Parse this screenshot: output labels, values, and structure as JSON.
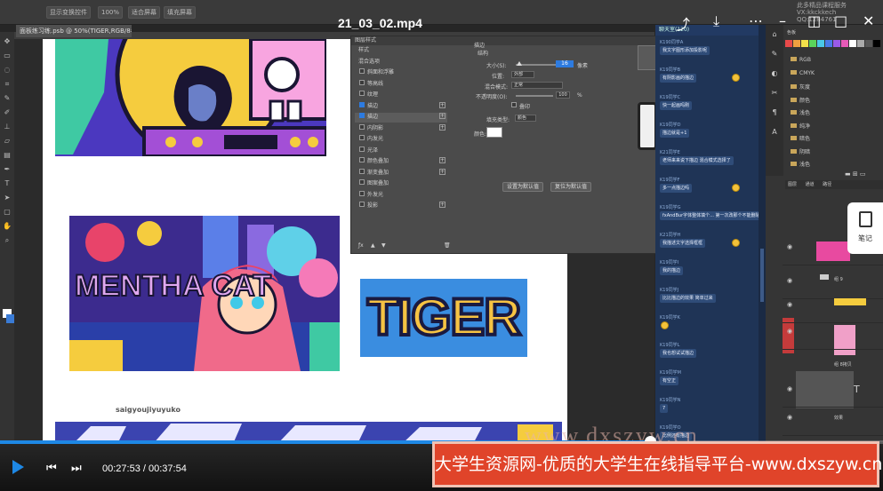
{
  "video": {
    "title": "21_03_02.mp4",
    "current_time": "00:27:53",
    "total_time": "00:37:54",
    "time_separator": "/",
    "progress_fraction": 0.736,
    "watermark_lines": [
      "此多精品课程服务",
      "VX:kkckkech",
      "QQ:1284761"
    ],
    "ghost_watermark": "www.dxszyw.cn",
    "banner_text": "大学生资源网-优质的大学生在线指导平台-www.dxszyw.cn",
    "accent_color": "#1e88e5"
  },
  "ps": {
    "option_pills": [
      "显示变换控件",
      "100%",
      "适合屏幕",
      "填充屏幕"
    ],
    "doc_tab": "面板练习练.psb @ 50%(TIGER,RGB/8#) *",
    "signature": "saigyoujiyuyuko",
    "tiger_text": "TIGER",
    "art_text": "MENTHA CAT"
  },
  "dialog": {
    "title": "图层样式",
    "left_items": [
      {
        "label": "样式",
        "checked": null,
        "plus": false
      },
      {
        "label": "混合选项",
        "checked": null,
        "plus": false
      },
      {
        "label": "斜面和浮雕",
        "checked": false,
        "plus": false
      },
      {
        "label": "等高线",
        "checked": false,
        "plus": false
      },
      {
        "label": "纹理",
        "checked": false,
        "plus": false
      },
      {
        "label": "描边",
        "checked": true,
        "plus": true
      },
      {
        "label": "描边",
        "checked": true,
        "plus": true
      },
      {
        "label": "内阴影",
        "checked": false,
        "plus": true
      },
      {
        "label": "内发光",
        "checked": false,
        "plus": false
      },
      {
        "label": "光泽",
        "checked": false,
        "plus": false
      },
      {
        "label": "颜色叠加",
        "checked": false,
        "plus": true
      },
      {
        "label": "渐变叠加",
        "checked": false,
        "plus": true
      },
      {
        "label": "图案叠加",
        "checked": false,
        "plus": false
      },
      {
        "label": "外发光",
        "checked": false,
        "plus": false
      },
      {
        "label": "投影",
        "checked": false,
        "plus": true
      }
    ],
    "section_title": "描边",
    "section_sub": "结构",
    "size_label": "大小(S):",
    "size_value": "16",
    "size_unit": "像素",
    "position_label": "位置:",
    "position_value": "外部",
    "blend_label": "混合模式:",
    "blend_value": "正常",
    "opacity_label": "不透明度(O):",
    "opacity_value": "100",
    "opacity_unit": "%",
    "overprint_label": "叠印",
    "fill_type_label": "填充类型:",
    "fill_type_value": "颜色",
    "color_label": "颜色:",
    "stroke_color": "#ffffff",
    "btn_default": "设置为默认值",
    "btn_reset": "复位为默认值"
  },
  "chat": {
    "header": "聊天室(120)",
    "messages": [
      {
        "name": "K190同学A",
        "text": "我文字图形添加投影呢"
      },
      {
        "name": "K19同学B",
        "text": "有阴影画的描边",
        "emoji": true
      },
      {
        "name": "K19同学C",
        "text": "快一起画吗刚"
      },
      {
        "name": "K19同学D",
        "text": "描边就是+1"
      },
      {
        "name": "K21同学E",
        "text": "老师来来说下描边 混合模式选择了"
      },
      {
        "name": "K19同学F",
        "text": "多一点描边吗",
        "emoji": true
      },
      {
        "name": "K19同学G",
        "text": "fxAndBur字体整体填个... 第一次改那个不能删除吗"
      },
      {
        "name": "K21同学H",
        "text": "我描述文字选择框框",
        "emoji": true
      },
      {
        "name": "K19同学I",
        "text": "我的描边"
      },
      {
        "name": "K19同学J",
        "text": "比比描边的效果 简单过来"
      },
      {
        "name": "K19同学K",
        "text": "",
        "emoji": true
      },
      {
        "name": "K19同学L",
        "text": "我也想试试描边"
      },
      {
        "name": "K19同学M",
        "text": "有空正"
      },
      {
        "name": "K19同学N",
        "text": "7"
      },
      {
        "name": "K19同学O",
        "text": "比例还有描边"
      }
    ]
  },
  "panels": {
    "top_label": "色板",
    "swatch_colors": [
      "#e84a4a",
      "#f0a040",
      "#f3e04a",
      "#5ad45a",
      "#4ac8e8",
      "#4a7ae8",
      "#9a5ae8",
      "#e85ab8",
      "#ffffff",
      "#aaaaaa",
      "#555555",
      "#000000"
    ],
    "folders": [
      "RGB",
      "CMYK",
      "灰度",
      "颜色",
      "浅色",
      "纯净",
      "暗色",
      "阴暗",
      "浅色"
    ],
    "layer_tabs": [
      "图层",
      "通道",
      "路径"
    ],
    "layers": [
      {
        "name": "",
        "kind": "art"
      },
      {
        "name": "组 9",
        "kind": "group"
      },
      {
        "name": "",
        "kind": "art"
      },
      {
        "name": "组 8拷贝",
        "kind": "group"
      },
      {
        "name": "T",
        "kind": "text"
      },
      {
        "name": "效果",
        "kind": "fx"
      }
    ],
    "notes_label": "笔记"
  }
}
